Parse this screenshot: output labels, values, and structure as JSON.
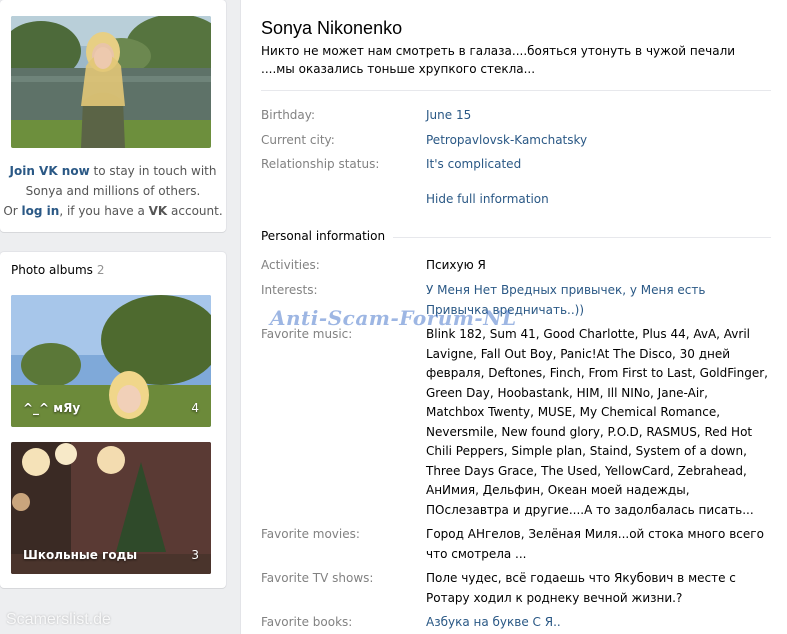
{
  "sidebar": {
    "join": {
      "join_link": "Join VK now",
      "line1_rest": " to stay in touch with",
      "line2": "Sonya and millions of others.",
      "line3_pre": "Or ",
      "login_link": "log in",
      "line3_mid": ", if you have a ",
      "vk": "VK",
      "line3_post": " account."
    },
    "albums": {
      "title": "Photo albums",
      "count": "2",
      "items": [
        {
          "name": "^_^ мЯу",
          "count": "4"
        },
        {
          "name": "Школьные годы",
          "count": "3"
        }
      ]
    }
  },
  "profile": {
    "name": "Sonya Nikonenko",
    "status": "Никто не может нам смотреть в галаза....бояться утонуть в чужой печали ....мы оказались тоньше хрупкого стекла...",
    "short_info": [
      {
        "label": "Birthday:",
        "value": "June 15"
      },
      {
        "label": "Current city:",
        "value": "Petropavlovsk-Kamchatsky"
      },
      {
        "label": "Relationship status:",
        "value": "It's complicated"
      }
    ],
    "hide_link": "Hide full information",
    "personal_title": "Personal information",
    "personal": [
      {
        "label": "Activities:",
        "value": "Психую Я"
      },
      {
        "label": "Interests:",
        "value": "У Меня Нет Вредных привычек, у Меня есть Привычка вредничать..))"
      },
      {
        "label": "Favorite music:",
        "value": "Blink 182, Sum 41, Good Charlotte, Plus 44, AvA, Avril Lavigne, Fall Out Boy, Panic!At The Disco, 30 дней февраля, Deftones, Finch, From First to Last, GoldFinger, Green Day, Hoobastank, HIM, Ill NINo, Jane-Air, Matchbox Twenty, MUSE, My Chemical Romance, Neversmile, New found glory, P.O.D, RASMUS, Red Hot Chili Peppers, Simple plan, Staind, System of a down, Three Days Grace, The Used, YellowCard, Zebrahead, АнИмия, Дельфин, Океан моей надежды, ПОслезавтра и другие....А то задолбалась писать..."
      },
      {
        "label": "Favorite movies:",
        "value": "Город АНгелов, Зелёная Миля...ой стока много всего что смотрела ..."
      },
      {
        "label": "Favorite TV shows:",
        "value": "Поле чудес, всё годаешь что Якубович в месте с Ротару ходил к роднеку вечной жизни.?"
      },
      {
        "label": "Favorite books:",
        "value": "Азбука на букве С Я.."
      }
    ]
  },
  "watermarks": {
    "center": "Anti-Scam-Forum-NL",
    "corner": "Scamerslist.de"
  }
}
